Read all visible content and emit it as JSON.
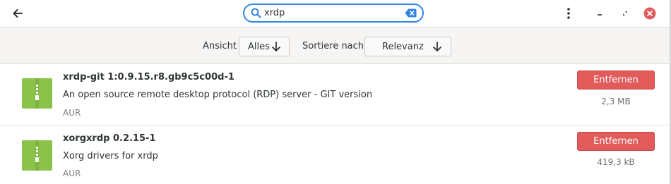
{
  "header": {
    "search_value": "xrdp",
    "icons": {
      "back": "back-arrow-icon",
      "search": "search-icon",
      "clear": "clear-icon",
      "menu": "kebab-menu-icon",
      "minimize": "minimize-icon",
      "restore": "restore-icon",
      "close": "close-icon"
    }
  },
  "filters": {
    "view_label": "Ansicht",
    "view_value": "Alles",
    "sort_label": "Sortiere nach",
    "sort_value": "Relevanz"
  },
  "packages": [
    {
      "name": "xrdp-git  1:0.9.15.r8.gb9c5c00d-1",
      "description": "An open source remote desktop protocol (RDP) server - GIT version",
      "repo": "AUR",
      "action": "Entfernen",
      "size": "2,3 MB"
    },
    {
      "name": "xorgxrdp  0.2.15-1",
      "description": "Xorg drivers for xrdp",
      "repo": "AUR",
      "action": "Entfernen",
      "size": "419,3 kB"
    }
  ],
  "colors": {
    "accent": "#3584e4",
    "remove_button": "#e15b5b",
    "close_button": "#e15b5b",
    "package_icon": "#8bc34a"
  }
}
